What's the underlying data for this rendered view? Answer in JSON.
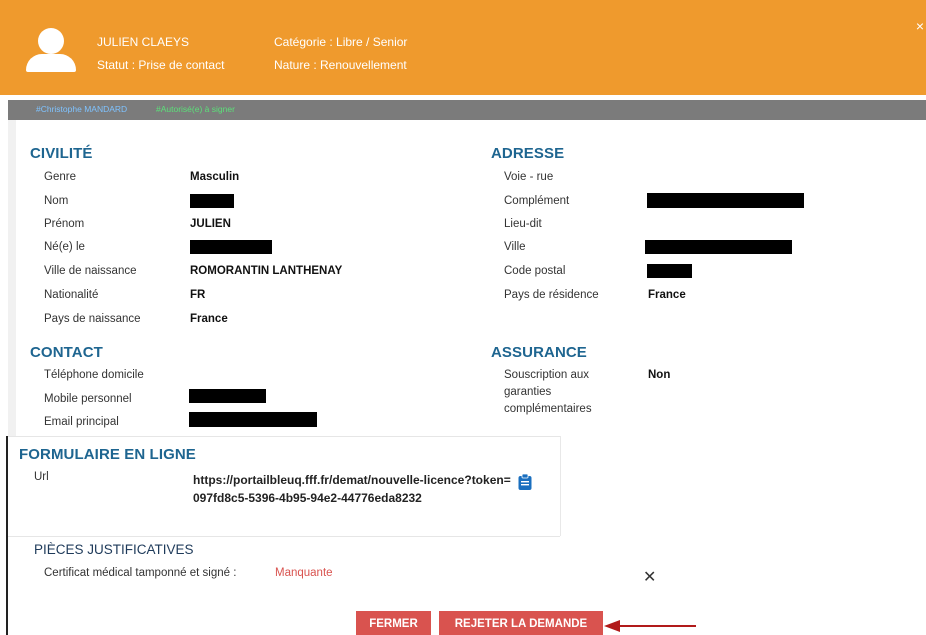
{
  "header": {
    "name": "JULIEN CLAEYS",
    "statut": "Statut : Prise de contact",
    "categorie": "Catégorie : Libre / Senior",
    "nature": "Nature : Renouvellement",
    "close": "×",
    "bg_color": "#EF9A2D"
  },
  "subbar": {
    "agent": "#Christophe MANDARD",
    "authorized": "#Autorisé(e) à signer"
  },
  "civilite": {
    "title": "CIVILITÉ",
    "rows": [
      {
        "label": "Genre",
        "value": "Masculin"
      },
      {
        "label": "Nom",
        "value": ""
      },
      {
        "label": "Prénom",
        "value": "JULIEN"
      },
      {
        "label": "Né(e) le",
        "value": ""
      },
      {
        "label": "Ville de naissance",
        "value": "ROMORANTIN LANTHENAY"
      },
      {
        "label": "Nationalité",
        "value": "FR"
      },
      {
        "label": "Pays de naissance",
        "value": "France"
      }
    ]
  },
  "adresse": {
    "title": "ADRESSE",
    "rows": [
      {
        "label": "Voie - rue",
        "value": ""
      },
      {
        "label": "Complément",
        "value": ""
      },
      {
        "label": "Lieu-dit",
        "value": ""
      },
      {
        "label": "Ville",
        "value": ""
      },
      {
        "label": "Code postal",
        "value": ""
      },
      {
        "label": "Pays de résidence",
        "value": "France"
      }
    ]
  },
  "contact": {
    "title": "CONTACT",
    "rows": [
      {
        "label": "Téléphone domicile",
        "value": ""
      },
      {
        "label": "Mobile personnel",
        "value": ""
      },
      {
        "label": "Email principal",
        "value": ""
      }
    ]
  },
  "assurance": {
    "title": "ASSURANCE",
    "label_line1": "Souscription aux",
    "label_line2": "garanties",
    "label_line3": "complémentaires",
    "value": "Non"
  },
  "formulaire": {
    "title": "FORMULAIRE EN LIGNE",
    "url_label": "Url",
    "url_value": "https://portailbleuq.fff.fr/demat/nouvelle-licence?token=097fd8c5-5396-4b95-94e2-44776eda8232"
  },
  "pieces": {
    "title": "PIÈCES JUSTIFICATIVES",
    "item_label": "Certificat médical tamponné et signé :",
    "item_status": "Manquante",
    "remove": "✕"
  },
  "buttons": {
    "close_label": "FERMER",
    "reject_label": "REJETER LA DEMANDE",
    "color": "#d9534f"
  }
}
